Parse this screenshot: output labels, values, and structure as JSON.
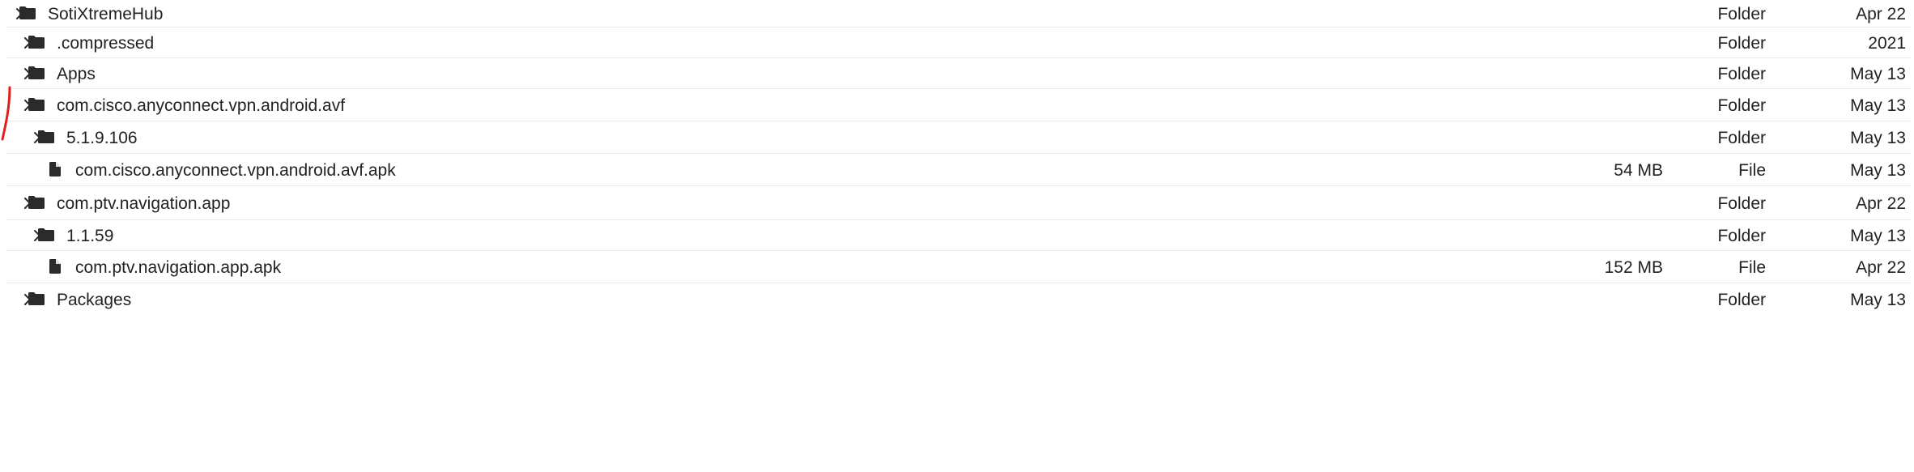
{
  "rows": [
    {
      "name": "SotiXtremeHub",
      "size": "",
      "type": "Folder",
      "modified": "Apr 22",
      "kind": "folder",
      "expandable": true,
      "depth": 0
    },
    {
      "name": ".compressed",
      "size": "",
      "type": "Folder",
      "modified": "2021",
      "kind": "folder",
      "expandable": true,
      "depth": 1
    },
    {
      "name": "Apps",
      "size": "",
      "type": "Folder",
      "modified": "May 13",
      "kind": "folder",
      "expandable": true,
      "depth": 1
    },
    {
      "name": "com.cisco.anyconnect.vpn.android.avf",
      "size": "",
      "type": "Folder",
      "modified": "May 13",
      "kind": "folder",
      "expandable": true,
      "depth": 2
    },
    {
      "name": "5.1.9.106",
      "size": "",
      "type": "Folder",
      "modified": "May 13",
      "kind": "folder",
      "expandable": true,
      "depth": 3
    },
    {
      "name": "com.cisco.anyconnect.vpn.android.avf.apk",
      "size": "54 MB",
      "type": "File",
      "modified": "May 13",
      "kind": "file",
      "expandable": false,
      "depth": 4
    },
    {
      "name": "com.ptv.navigation.app",
      "size": "",
      "type": "Folder",
      "modified": "Apr 22",
      "kind": "folder",
      "expandable": true,
      "depth": 2
    },
    {
      "name": "1.1.59",
      "size": "",
      "type": "Folder",
      "modified": "May 13",
      "kind": "folder",
      "expandable": true,
      "depth": 3
    },
    {
      "name": "com.ptv.navigation.app.apk",
      "size": "152 MB",
      "type": "File",
      "modified": "Apr 22",
      "kind": "file",
      "expandable": false,
      "depth": 4
    },
    {
      "name": "Packages",
      "size": "",
      "type": "Folder",
      "modified": "May 13",
      "kind": "folder",
      "expandable": true,
      "depth": 1
    }
  ],
  "icons": {
    "expand": "chevron-right-icon",
    "folder": "folder-icon",
    "file": "file-icon"
  },
  "colors": {
    "text": "#222222",
    "icon": "#2b2b2b",
    "divider": "#e9e9e9",
    "annotation_mark": "#e0201b"
  }
}
